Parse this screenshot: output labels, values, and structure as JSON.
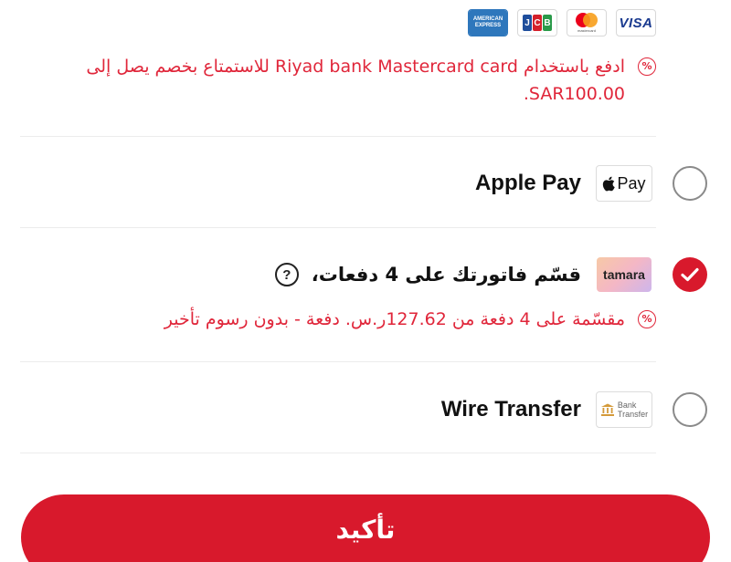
{
  "card_logos": {
    "visa": "VISA",
    "mastercard_label": "mastercard",
    "jcb_letters": [
      "J",
      "C",
      "B"
    ],
    "amex_lines": [
      "AMERICAN",
      "EXPRESS"
    ]
  },
  "card_promo": {
    "icon": "percent-badge-icon",
    "text_line1": "ادفع باستخدام Riyad bank Mastercard card للاستمتاع بخصم يصل إلى",
    "text_line2": "SAR100.00."
  },
  "methods": {
    "apple_pay": {
      "label": "Apple Pay",
      "logo_text": "Pay",
      "selected": false
    },
    "tamara": {
      "label": "قسّم فاتورتك على 4 دفعات،",
      "logo_text": "tamara",
      "help": "?",
      "selected": true,
      "promo": "مقسّمة على 4 دفعة من 127.62ر.س. دفعة - بدون رسوم تأخير"
    },
    "wire_transfer": {
      "label": "Wire Transfer",
      "logo_text_line1": "Bank",
      "logo_text_line2": "Transfer",
      "selected": false
    }
  },
  "confirm_button": {
    "label": "تأكيد"
  },
  "colors": {
    "accent": "#d8192c",
    "promo_text": "#e0263a",
    "divider": "#ececec",
    "radio_border": "#8a8a8a"
  }
}
